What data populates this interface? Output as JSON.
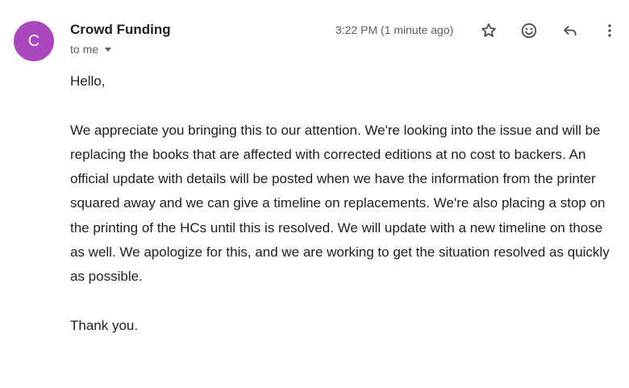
{
  "message": {
    "avatar_letter": "C",
    "sender_name": "Crowd Funding",
    "recipient_label": "to me",
    "timestamp": "3:22 PM (1 minute ago)",
    "greeting": "Hello,",
    "paragraph": "We appreciate you bringing this to our attention. We're looking into the issue and will be replacing the books that are affected with corrected editions at no cost to backers. An official update with details will be posted when we have the information from the printer squared away and we can give a timeline on replacements. We're also placing a stop on the printing of the HCs until this is resolved. We will update with a new timeline on those as well. We apologize for this, and we are working to get the situation resolved as quickly as possible.",
    "closing": "Thank you."
  },
  "actions": {
    "star_icon": "star-icon",
    "emoji_icon": "emoji-reaction-icon",
    "reply_icon": "reply-icon",
    "more_icon": "more-vert-icon"
  },
  "colors": {
    "avatar_bg": "#ab47bc",
    "text": "#1f1f1f",
    "muted": "#5e5e5e",
    "icon": "#444746"
  }
}
